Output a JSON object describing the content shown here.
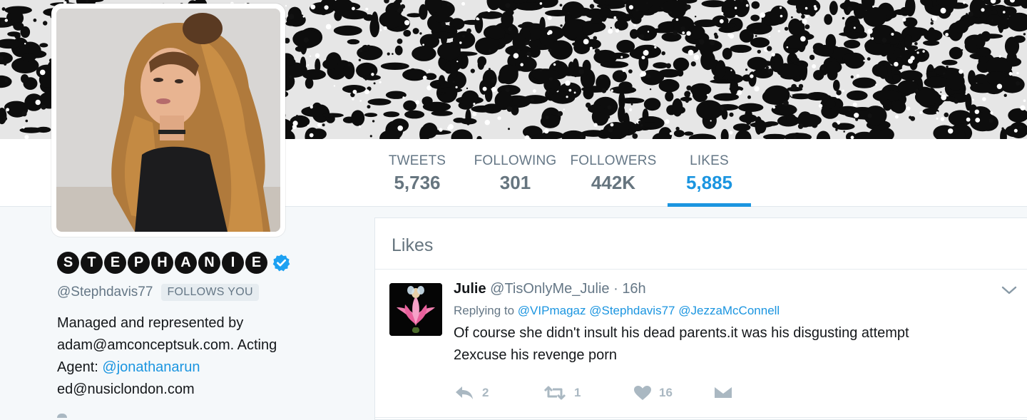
{
  "nav": {
    "stats": [
      {
        "label": "TWEETS",
        "value": "5,736"
      },
      {
        "label": "FOLLOWING",
        "value": "301"
      },
      {
        "label": "FOLLOWERS",
        "value": "442K"
      },
      {
        "label": "LIKES",
        "value": "5,885"
      }
    ],
    "active_tab": "LIKES"
  },
  "profile": {
    "name_letters": [
      "S",
      "T",
      "E",
      "P",
      "H",
      "A",
      "N",
      "I",
      "E"
    ],
    "handle": "@Stephdavis77",
    "follows_badge": "FOLLOWS YOU",
    "bio_line1": "Managed and represented by",
    "bio_line2": "adam@amconceptsuk.com. Acting",
    "bio_line3_prefix": "Agent: ",
    "bio_line3_link": "@jonathanarun",
    "bio_line4": "ed@nusiclondon.com"
  },
  "timeline": {
    "title": "Likes",
    "tweet": {
      "name": "Julie",
      "handle": "@TisOnlyMe_Julie",
      "separator": " · ",
      "time": "16h",
      "replying_prefix": "Replying to",
      "mentions": [
        "@VIPmagaz",
        "@Stephdavis77",
        "@JezzaMcConnell"
      ],
      "text_line1": "Of course she didn't insult his dead parents.it was his disgusting attempt",
      "text_line2": "2excuse his revenge porn",
      "reply_count": "2",
      "retweet_count": "1",
      "like_count": "16"
    }
  },
  "colors": {
    "accent": "#1b95e0",
    "muted": "#657786",
    "icon": "#aab8c2"
  }
}
